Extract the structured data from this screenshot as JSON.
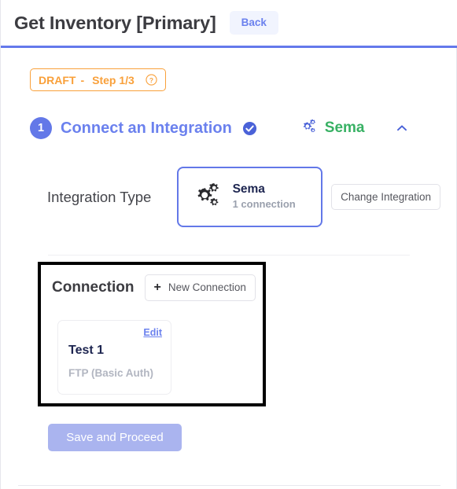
{
  "header": {
    "title": "Get Inventory [Primary]",
    "back_label": "Back",
    "accent_color": "#6479eb"
  },
  "status_badge": {
    "state": "DRAFT",
    "separator": "-",
    "step": "Step 1/3",
    "help_icon": "question-circle-icon",
    "color": "#f9a03a"
  },
  "step": {
    "number": "1",
    "title": "Connect an Integration",
    "completed_icon": "check-circle-icon",
    "integration_icon": "gears-icon",
    "integration_name": "Sema",
    "integration_color": "#38b164",
    "collapse_icon": "chevron-up-icon"
  },
  "integration_type": {
    "label": "Integration Type",
    "card": {
      "icon": "gears-icon",
      "name": "Sema",
      "subtitle": "1 connection"
    },
    "change_label": "Change Integration"
  },
  "connection": {
    "title": "Connection",
    "new_button": {
      "icon": "plus-icon",
      "label": "New Connection"
    },
    "cards": [
      {
        "edit_label": "Edit",
        "name": "Test 1",
        "type": "FTP (Basic Auth)"
      }
    ]
  },
  "footer": {
    "save_label": "Save and Proceed",
    "save_color": "#aab4ef"
  }
}
